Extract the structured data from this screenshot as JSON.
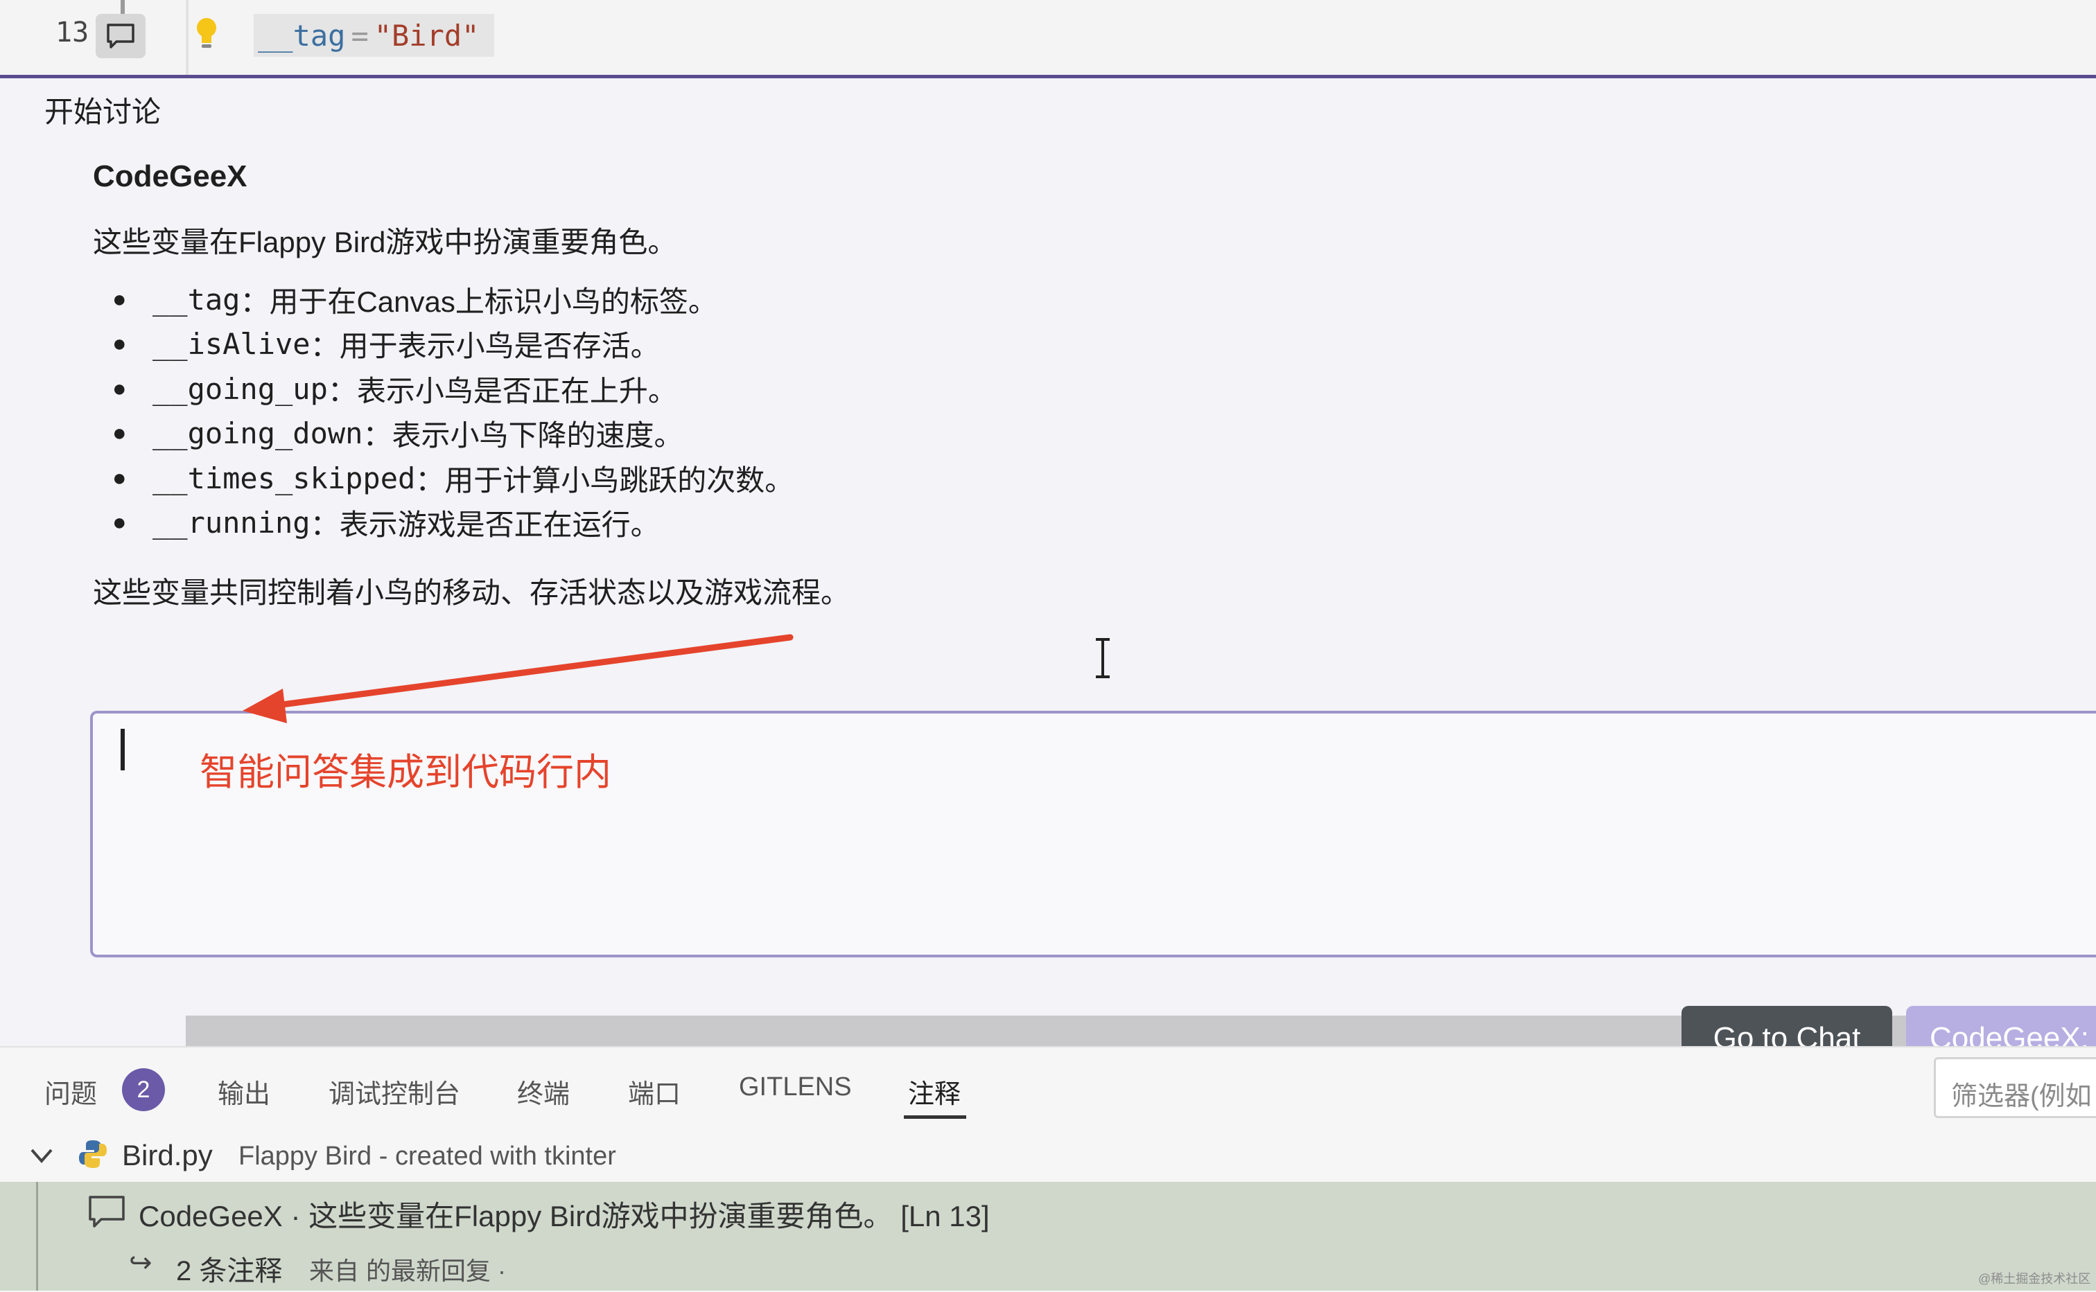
{
  "editor": {
    "line_number": "13",
    "code_var": "__tag",
    "code_op": "=",
    "code_str": "\"Bird\""
  },
  "discussion": {
    "title": "开始讨论",
    "author": "CodeGeeX",
    "summary": "这些变量在Flappy Bird游戏中扮演重要角色。",
    "items": [
      {
        "name": "__tag",
        "desc": "：用于在Canvas上标识小鸟的标签。"
      },
      {
        "name": "__isAlive",
        "desc": "：用于表示小鸟是否存活。"
      },
      {
        "name": "__going_up",
        "desc": "：表示小鸟是否正在上升。"
      },
      {
        "name": "__going_down",
        "desc": "：表示小鸟下降的速度。"
      },
      {
        "name": "__times_skipped",
        "desc": "：用于计算小鸟跳跃的次数。"
      },
      {
        "name": "__running",
        "desc": "：表示游戏是否正在运行。"
      }
    ],
    "conclusion": "这些变量共同控制着小鸟的移动、存活状态以及游戏流程。",
    "annotation": "智能问答集成到代码行内"
  },
  "buttons": {
    "go_to_chat": "Go to Chat",
    "codegeex": "CodeGeeX:"
  },
  "panel": {
    "tabs": [
      "问题",
      "输出",
      "调试控制台",
      "终端",
      "端口",
      "GITLENS",
      "注释"
    ],
    "problems_count": "2",
    "active_tab": "注释",
    "filter_placeholder": "筛选器(例如"
  },
  "comments": {
    "file_name": "Bird.py",
    "file_description": "Flappy Bird - created with tkinter",
    "comment_text": "CodeGeeX · 这些变量在Flappy Bird游戏中扮演重要角色。 [Ln 13]",
    "reply_count": "2 条注释",
    "reply_from": "来自  的最新回复 ·"
  },
  "watermark": "@稀土掘金技术社区",
  "colors": {
    "accent": "#6a5aa8",
    "annotation": "#e5442c",
    "comment_row": "#cfd8cb"
  }
}
